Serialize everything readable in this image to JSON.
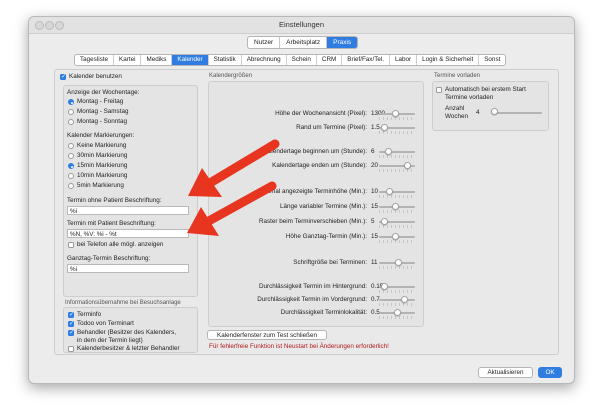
{
  "window": {
    "title": "Einstellungen"
  },
  "segments": [
    "Nutzer",
    "Arbeitsplatz",
    "Praxis"
  ],
  "tabs": [
    "Tagesliste",
    "Kartei",
    "Mediks",
    "Kalender",
    "Statistik",
    "Abrechnung",
    "Schein",
    "CRM",
    "Brief/Fax/Tel.",
    "Labor",
    "Login & Sicherheit",
    "Sonst"
  ],
  "left": {
    "use_calendar": "Kalender benutzen",
    "weekdays_heading": "Anzeige der Wochentage:",
    "weekdays": [
      "Montag - Freitag",
      "Montag - Samstag",
      "Montag - Sonntag"
    ],
    "markings_heading": "Kalender Markierungen:",
    "markings": [
      "Keine Markierung",
      "30min Markierung",
      "15min Markierung",
      "10min Markierung",
      "5min Markierung"
    ],
    "term_no_patient_label": "Termin ohne Patient Beschriftung:",
    "term_no_patient_value": "%i",
    "term_patient_label": "Termin mit Patient Beschriftung:",
    "term_patient_value": "%N, %V: %i - %t",
    "phone_all": "bei Telefon alle mögl. anzeigen",
    "allday_label": "Ganztag-Termin Beschriftung:",
    "allday_value": "%i",
    "info_heading": "Informationsübernahme bei Besuchsanlage",
    "info_items": [
      "Terminfo",
      "Todoo von Terminart",
      "Behandler (Besitzer des Kalenders,",
      "in dem der Termin liegt)",
      "Kalenderbesitzer & letzter Behandler"
    ]
  },
  "sizes": {
    "heading": "Kalendergrößen",
    "rows": [
      {
        "label": "Höhe der Wochenansicht (Pixel):",
        "value": "1300",
        "pos": 0.45
      },
      {
        "label": "Rand um Termine (Pixel):",
        "value": "1.5",
        "pos": 0.15
      },
      {
        "label": "Kalendertage beginnen um (Stunde):",
        "value": "6",
        "pos": 0.25
      },
      {
        "label": "Kalendertage enden um (Stunde):",
        "value": "20",
        "pos": 0.8
      },
      {
        "label": "Minimal angezeigte Terminhöhe (Min.):",
        "value": "10",
        "pos": 0.3
      },
      {
        "label": "Länge variabler Termine (Min.):",
        "value": "15",
        "pos": 0.45
      },
      {
        "label": "Raster beim Terminverschieben (Min.):",
        "value": "5",
        "pos": 0.15
      },
      {
        "label": "Höhe Ganztag-Termin (Min.):",
        "value": "15",
        "pos": 0.45
      },
      {
        "label": "Schriftgröße bei Terminen:",
        "value": "11",
        "pos": 0.55
      },
      {
        "label": "Durchlässigkeit Termin im Hintergrund:",
        "value": "0.15",
        "pos": 0.15
      },
      {
        "label": "Durchlässigkeit Termin im Vordergrund:",
        "value": "0.7",
        "pos": 0.7
      },
      {
        "label": "Durchlässigkeit Terminlokalität:",
        "value": "0.5",
        "pos": 0.5
      }
    ]
  },
  "preload": {
    "heading": "Termine vorladen",
    "auto": "Automatisch bei erstem Start",
    "auto2": "Termine vorladen",
    "weeks_label": "Anzahl",
    "weeks_label2": "Wochen",
    "weeks_value": "4",
    "weeks_pos": 0.05
  },
  "close_test": "Kalenderfenster zum Test schließen",
  "restart_note": "Für fehlerfreie Funktion ist Neustart bei Änderungen erforderlich!",
  "buttons": {
    "refresh": "Aktualisieren",
    "ok": "OK"
  },
  "colors": {
    "accent": "#2f7de1",
    "warning": "#b01818",
    "arrow": "#e8351f"
  }
}
